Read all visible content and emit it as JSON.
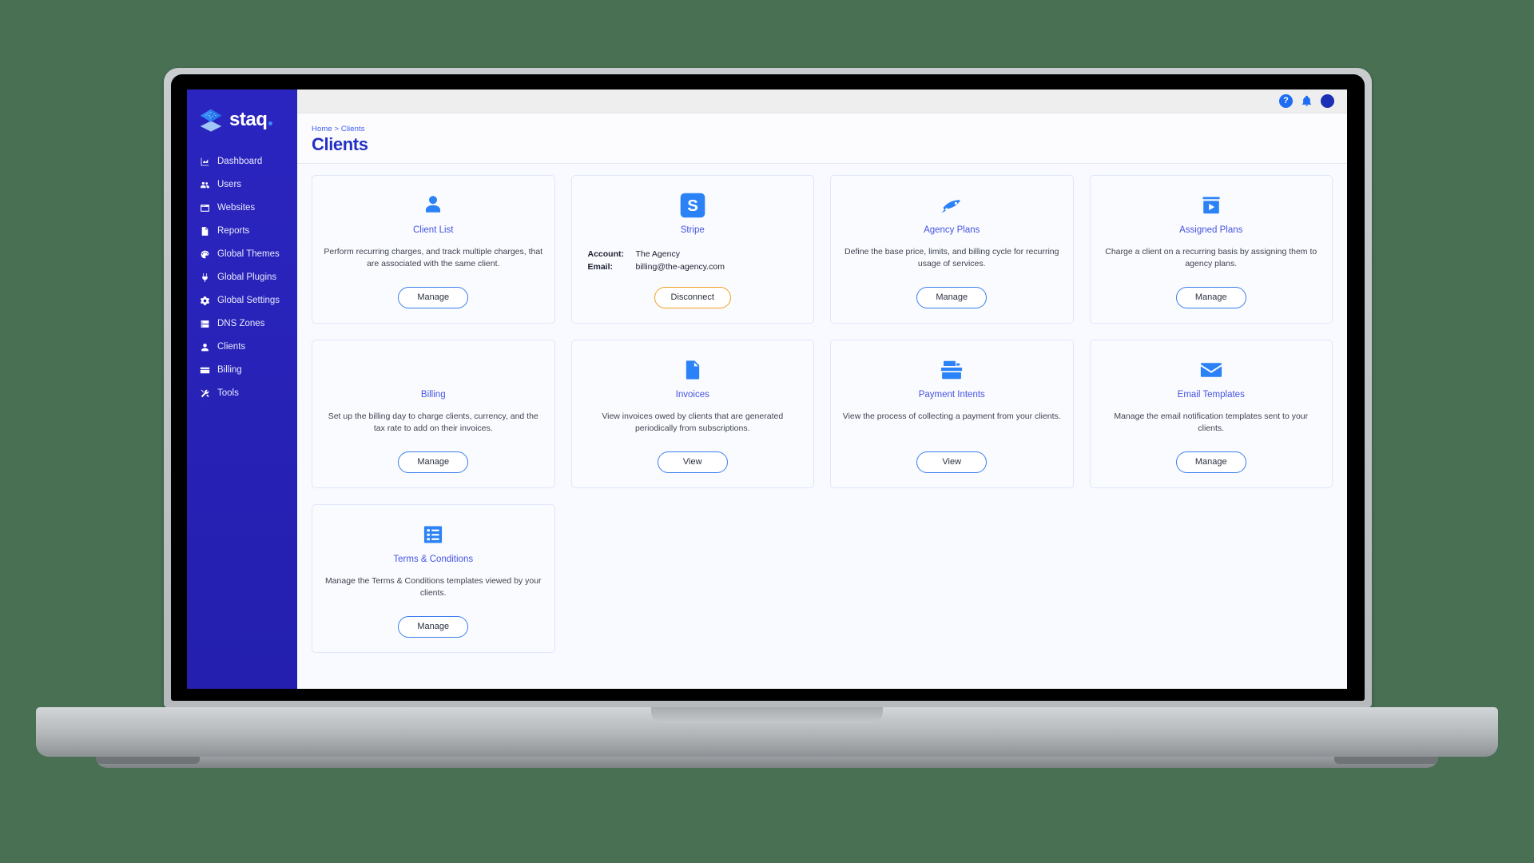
{
  "app": {
    "logo_text": "staq",
    "logo_dot": "",
    "brand_color": "#2320b0",
    "accent_color": "#2b82f6",
    "title_color": "#2332c2"
  },
  "topbar": {
    "help_label": "?",
    "help_icon": "question-mark-icon",
    "bell_icon": "bell-icon",
    "avatar_icon": "user-avatar"
  },
  "sidebar": {
    "items": [
      {
        "label": "Dashboard",
        "icon": "chart-bar-icon"
      },
      {
        "label": "Users",
        "icon": "users-icon"
      },
      {
        "label": "Websites",
        "icon": "browser-window-icon"
      },
      {
        "label": "Reports",
        "icon": "document-icon"
      },
      {
        "label": "Global Themes",
        "icon": "palette-icon"
      },
      {
        "label": "Global Plugins",
        "icon": "plug-icon"
      },
      {
        "label": "Global Settings",
        "icon": "gear-icon"
      },
      {
        "label": "DNS Zones",
        "icon": "server-icon"
      },
      {
        "label": "Clients",
        "icon": "person-icon"
      },
      {
        "label": "Billing",
        "icon": "credit-card-icon"
      },
      {
        "label": "Tools",
        "icon": "wrench-screwdriver-icon"
      }
    ]
  },
  "page": {
    "breadcrumb": "Home > Clients",
    "title": "Clients"
  },
  "cards": [
    {
      "id": "client-list",
      "icon": "person-icon",
      "title": "Client List",
      "desc": "Perform recurring charges, and track multiple charges, that are associated with the same client.",
      "button": "Manage",
      "button_style": "primary"
    },
    {
      "id": "stripe",
      "icon": "stripe-icon",
      "title": "Stripe",
      "account_key": "Account:",
      "account_value": "The Agency",
      "email_key": "Email:",
      "email_value": "billing@the-agency.com",
      "button": "Disconnect",
      "button_style": "warn"
    },
    {
      "id": "agency-plans",
      "icon": "plans-icon",
      "title": "Agency Plans",
      "desc": "Define the base price, limits, and billing cycle for recurring usage of services.",
      "button": "Manage",
      "button_style": "primary"
    },
    {
      "id": "assigned-plans",
      "icon": "assigned-plans-icon",
      "title": "Assigned Plans",
      "desc": "Charge a client on a recurring basis by assigning them to agency plans.",
      "button": "Manage",
      "button_style": "primary"
    },
    {
      "id": "billing",
      "icon": "credit-card-icon",
      "title": "Billing",
      "desc": "Set up the billing day to charge clients, currency, and the tax rate to add on their invoices.",
      "button": "Manage",
      "button_style": "primary"
    },
    {
      "id": "invoices",
      "icon": "invoice-icon",
      "title": "Invoices",
      "desc": "View invoices owed by clients that are generated periodically from subscriptions.",
      "button": "View",
      "button_style": "primary"
    },
    {
      "id": "payment-intents",
      "icon": "cash-register-icon",
      "title": "Payment Intents",
      "desc": "View the process of collecting a payment from your clients.",
      "button": "View",
      "button_style": "primary"
    },
    {
      "id": "email-templates",
      "icon": "envelope-icon",
      "title": "Email Templates",
      "desc": "Manage the email notification templates sent to your clients.",
      "button": "Manage",
      "button_style": "primary"
    },
    {
      "id": "terms-conditions",
      "icon": "list-document-icon",
      "title": "Terms & Conditions",
      "desc": "Manage the Terms & Conditions templates viewed by your clients.",
      "button": "Manage",
      "button_style": "primary"
    }
  ]
}
